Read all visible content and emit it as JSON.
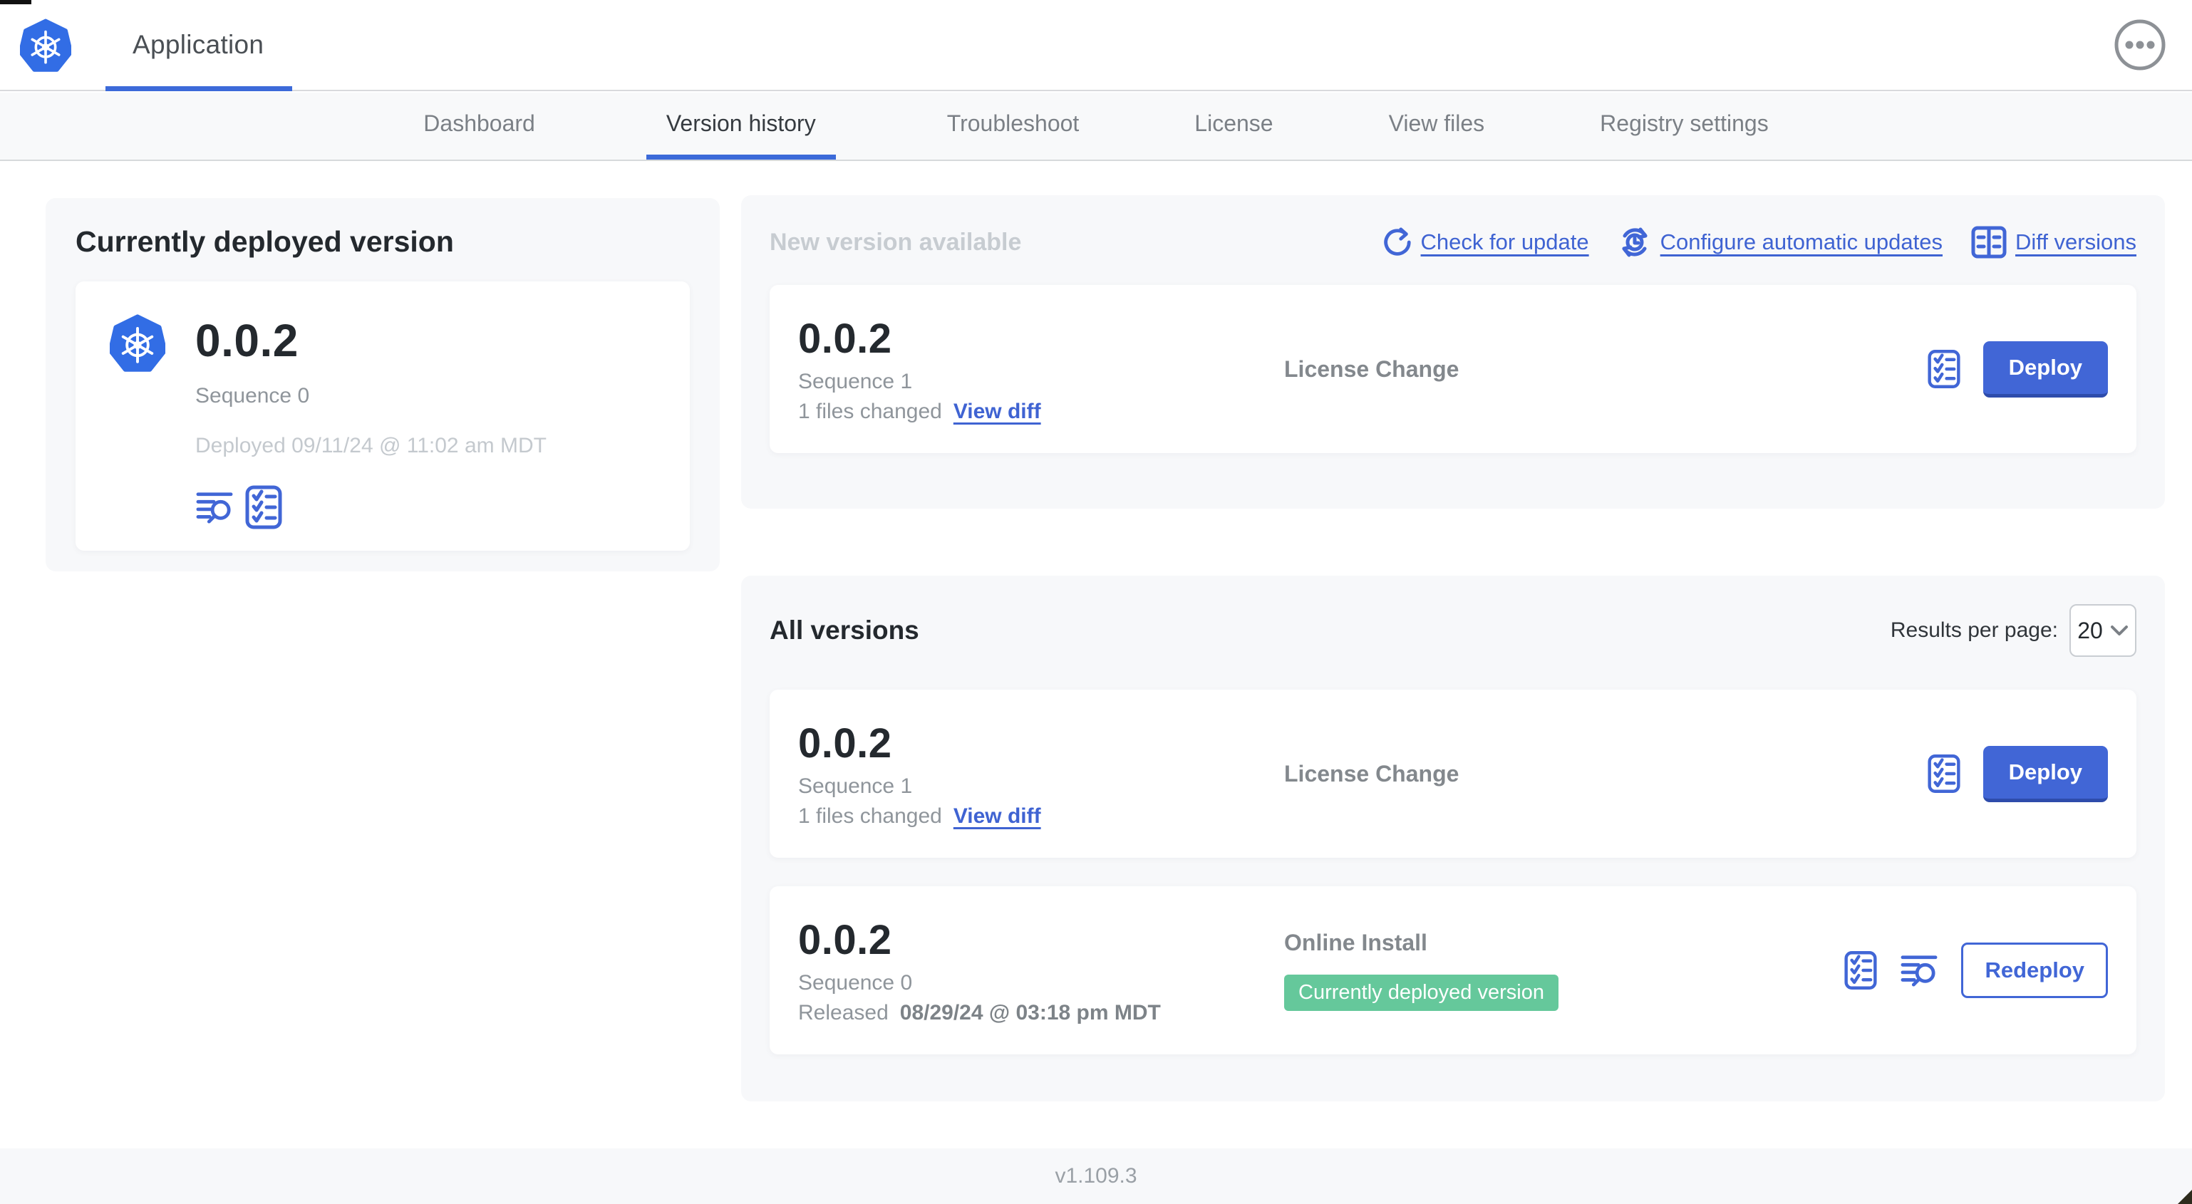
{
  "header": {
    "app_name": "Application"
  },
  "nav": {
    "tabs": [
      {
        "label": "Dashboard",
        "active": false
      },
      {
        "label": "Version history",
        "active": true
      },
      {
        "label": "Troubleshoot",
        "active": false
      },
      {
        "label": "License",
        "active": false
      },
      {
        "label": "View files",
        "active": false
      },
      {
        "label": "Registry settings",
        "active": false
      }
    ]
  },
  "currently_deployed": {
    "title": "Currently deployed version",
    "version": "0.0.2",
    "sequence": "Sequence 0",
    "deployed": "Deployed 09/11/24 @ 11:02 am MDT"
  },
  "new_version": {
    "title": "New version available",
    "actions": {
      "check_for_update": "Check for update",
      "configure_automatic_updates": "Configure automatic updates",
      "diff_versions": "Diff versions"
    },
    "row": {
      "version": "0.0.2",
      "sequence": "Sequence 1",
      "files_changed": "1 files changed",
      "view_diff": "View diff",
      "change_type": "License Change",
      "deploy_label": "Deploy"
    }
  },
  "all_versions": {
    "title": "All versions",
    "results_per_page_label": "Results per page:",
    "results_per_page_value": "20",
    "rows": [
      {
        "version": "0.0.2",
        "sequence": "Sequence 1",
        "files_changed": "1 files changed",
        "view_diff": "View diff",
        "change_type": "License Change",
        "deploy_label": "Deploy"
      },
      {
        "version": "0.0.2",
        "sequence": "Sequence 0",
        "released_prefix": "Released",
        "released_date": "08/29/24 @ 03:18 pm MDT",
        "change_type": "Online Install",
        "badge": "Currently deployed version",
        "redeploy_label": "Redeploy"
      }
    ]
  },
  "footer": {
    "app_version": "v1.109.3"
  },
  "icons": {
    "logo": "kubernetes-helm-wheel-icon",
    "menu": "ellipsis-circle-icon",
    "check_update": "refresh-arrow-icon",
    "auto_update": "sync-clock-icon",
    "diff": "side-by-side-diff-icon",
    "logs": "deploy-logs-magnifier-icon",
    "preflight": "preflight-checklist-icon",
    "select_chevron": "chevron-down-icon"
  },
  "colors": {
    "accent_blue": "#4166d6",
    "logo_blue": "#326de6",
    "badge_green": "#65c89b",
    "nav_bg": "#f8f9fa",
    "card_bg": "#f7f8fa"
  }
}
